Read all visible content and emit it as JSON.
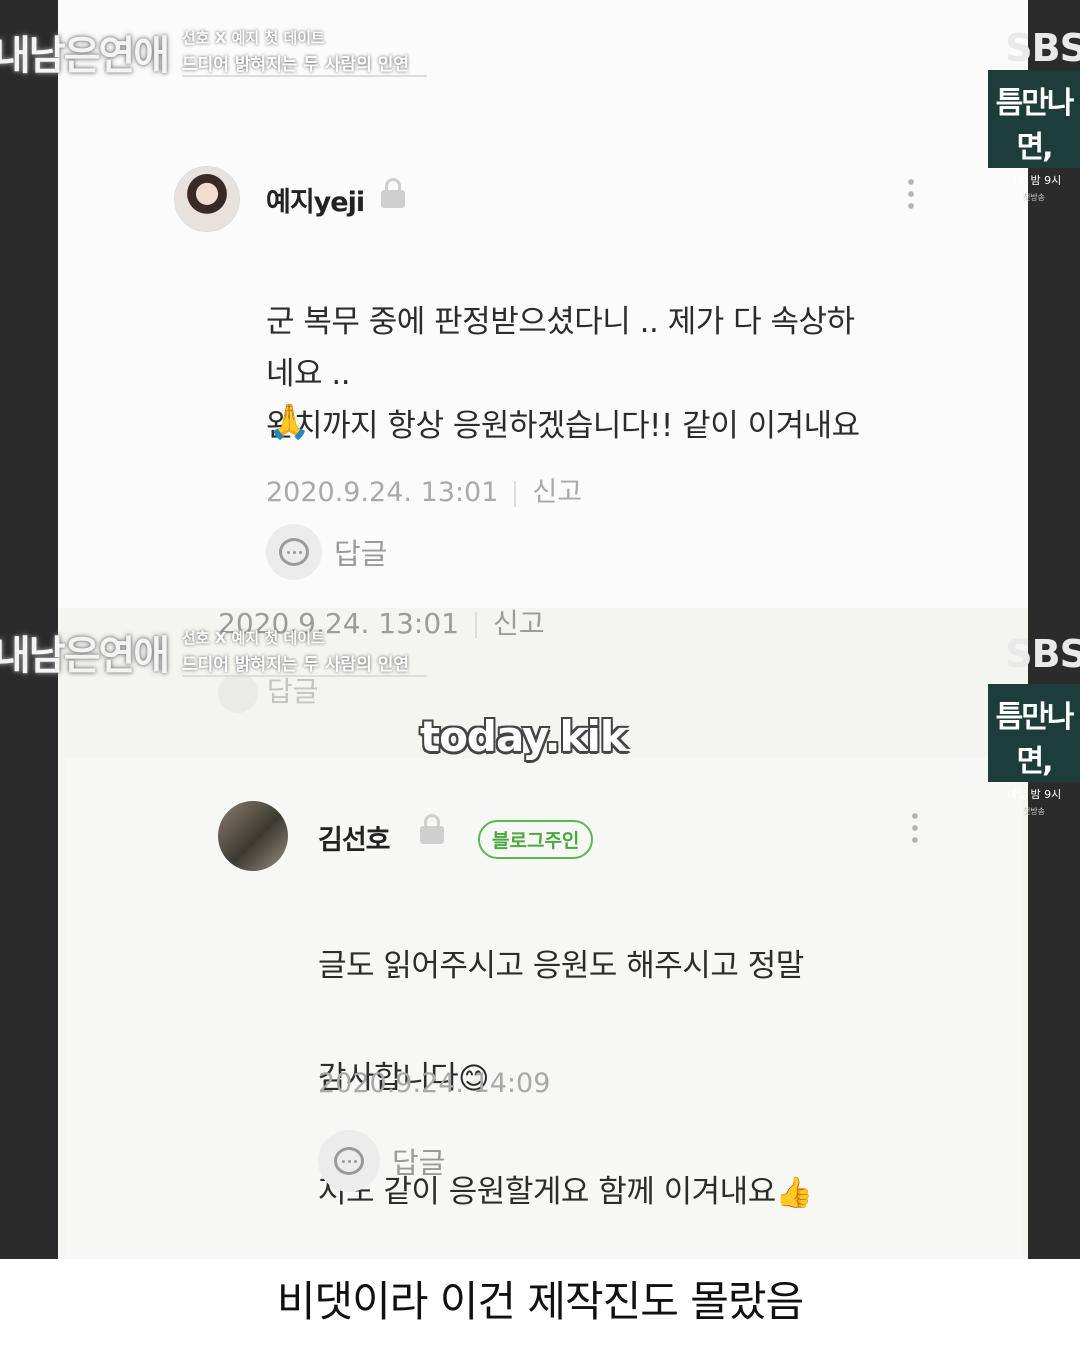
{
  "overlay": {
    "show_title": "내남은연애",
    "caption_line1": "선호 X 예지 첫 데이트",
    "caption_line2": "드디어 밝혀지는 두 사람의 인연",
    "network_logo": "SBS",
    "promo_title": "틈만나면,",
    "promo_time": "내일 밤 9시",
    "promo_sub": "첫방송"
  },
  "comment1": {
    "username": "예지yeji",
    "text": "군 복무 중에 판정받으셨다니 .. 제가 다 속상하\n네요 ..\n완치까지 항상 응원하겠습니다!! 같이 이겨내요",
    "emoji": "🙏",
    "timestamp": "2020.9.24. 13:01",
    "report_label": "신고",
    "reply_label": "답글"
  },
  "overlap": {
    "timestamp": "2020.9.24. 13:01",
    "report_label": "신고",
    "reply_label": "답글"
  },
  "watermark": "today.kik",
  "comment2": {
    "username": "김선호",
    "badge": "블로그주인",
    "line1": "글도 읽어주시고 응원도 해주시고 정말",
    "line2": "감사합니다",
    "line2_emoji": "😊",
    "line3": "저도 같이 응원할게요 함께 이겨내요",
    "line3_emoji": "👍",
    "timestamp": "2020.9.24. 14:09",
    "reply_label": "답글"
  },
  "bottom_caption": "비댓이라 이건 제작진도 몰랐음"
}
